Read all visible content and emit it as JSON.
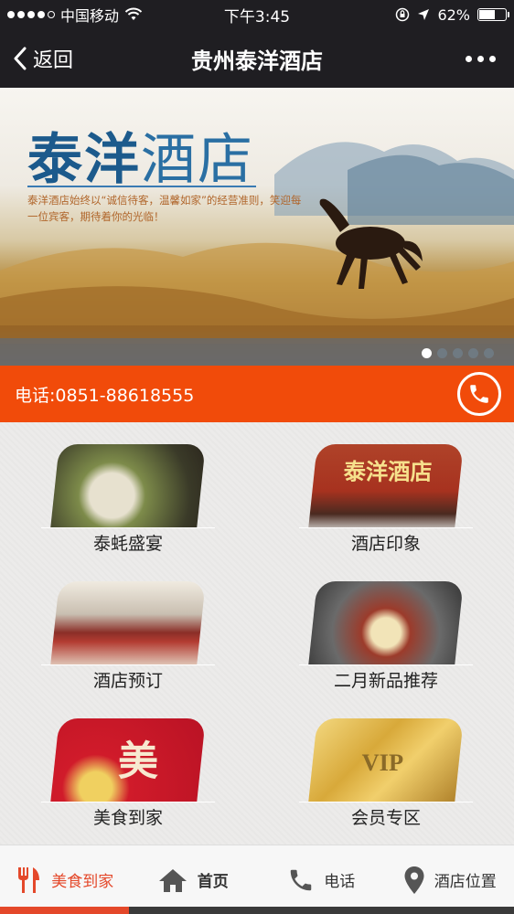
{
  "status_bar": {
    "carrier": "中国移动",
    "time": "下午3:45",
    "battery_percent": "62%",
    "battery_level": 0.62,
    "signal_bars": 4
  },
  "nav": {
    "back_label": "返回",
    "title": "贵州泰洋酒店"
  },
  "banner": {
    "title_bold": "泰洋",
    "title_light": "酒店",
    "slogan": "泰洋酒店始终以“诚信待客，温馨如家”的经营准则，笑迎每一位宾客，期待着你的光临！",
    "active_slide": 1,
    "slide_count": 5
  },
  "phone": {
    "label": "电话:0851-88618555"
  },
  "tiles": [
    {
      "label": "泰蚝盛宴",
      "image": "oyster-feast"
    },
    {
      "label": "酒店印象",
      "image": "hotel-facade",
      "sign_text": "泰洋酒店"
    },
    {
      "label": "酒店预订",
      "image": "hotel-hall"
    },
    {
      "label": "二月新品推荐",
      "image": "new-dish"
    },
    {
      "label": "美食到家",
      "image": "food-delivery",
      "sign_text": "美"
    },
    {
      "label": "会员专区",
      "image": "vip-card",
      "sign_text": "VIP"
    }
  ],
  "tabs": [
    {
      "label": "美食到家",
      "icon": "fork-knife-icon",
      "active": true
    },
    {
      "label": "首页",
      "icon": "home-icon",
      "active": false
    },
    {
      "label": "电话",
      "icon": "phone-icon",
      "active": false
    },
    {
      "label": "酒店位置",
      "icon": "location-pin-icon",
      "active": false
    }
  ],
  "colors": {
    "accent": "#f14b0a",
    "active_tab": "#e4482a",
    "bar_background": "#1f1e22"
  }
}
